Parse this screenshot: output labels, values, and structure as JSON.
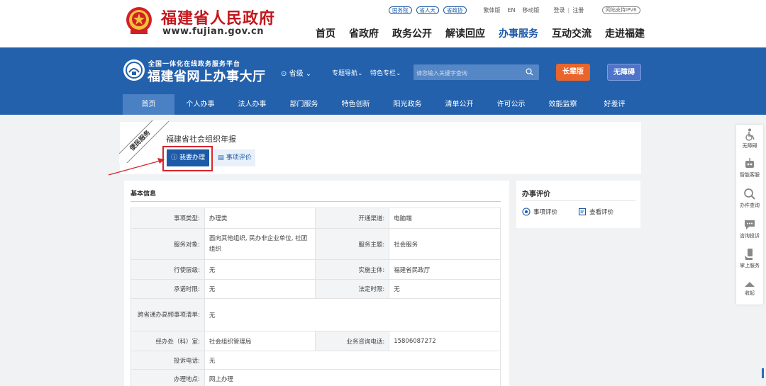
{
  "gov_header": {
    "site_name": "福建省人民政府",
    "site_url": "www.fujian.gov.cn",
    "pills": [
      "国务院",
      "省人大",
      "省政协"
    ],
    "links": [
      "繁体版",
      "EN",
      "移动版"
    ],
    "login": "登录",
    "register": "注册",
    "ipv6": "网站支持IPV6",
    "nav": [
      "首页",
      "省政府",
      "政务公开",
      "解读回应",
      "办事服务",
      "互动交流",
      "走进福建"
    ]
  },
  "hall": {
    "subtitle": "全国一体化在线政务服务平台",
    "title": "福建省网上办事大厅",
    "level": "省级",
    "topic_nav": "专题导航",
    "feature_col": "特色专栏",
    "search_placeholder": "请您输入关键字查询",
    "elder_btn": "长辈版",
    "access_btn": "无障碍",
    "sub_nav": [
      "首页",
      "个人办事",
      "法人办事",
      "部门服务",
      "特色创新",
      "阳光政务",
      "清单公开",
      "许可公示",
      "效能监察",
      "好差评"
    ]
  },
  "service": {
    "ribbon": "便民服务",
    "title": "福建省社会组织年报",
    "apply_btn": "我要办理",
    "eval_btn": "事项评价"
  },
  "basic_info": {
    "title": "基本信息",
    "rows": [
      {
        "l1": "事项类型:",
        "v1": "办理类",
        "l2": "开通渠道:",
        "v2": "电脑端"
      },
      {
        "l1": "服务对象:",
        "v1": "面向其他组织, 民办非企业单位, 社团组织",
        "l2": "服务主题:",
        "v2": "社会服务"
      },
      {
        "l1": "行使层级:",
        "v1": "无",
        "l2": "实施主体:",
        "v2": "福建省民政厅"
      },
      {
        "l1": "承诺时限:",
        "v1": "无",
        "l2": "法定时限:",
        "v2": "无"
      },
      {
        "l1": "跨省通办高频事项清单:",
        "v1": "无"
      },
      {
        "l1": "经办处（科）室:",
        "v1": "社会组织管理局",
        "l2": "业务咨询电话:",
        "v2": "15806087272"
      },
      {
        "l1": "投诉电话:",
        "v1": "无"
      },
      {
        "l1": "办理地点:",
        "v1": "网上办理"
      }
    ]
  },
  "eval_panel": {
    "title": "办事评价",
    "link1": "事项评价",
    "link2": "查看评价"
  },
  "float_bar": [
    "无障碍",
    "智能客服",
    "办件查询",
    "咨询投诉",
    "掌上服务",
    "收起"
  ],
  "colors": {
    "brand_blue": "#2361ad",
    "gov_red": "#c4161c",
    "elder_orange": "#e9652c",
    "highlight_red": "#d7262b"
  }
}
